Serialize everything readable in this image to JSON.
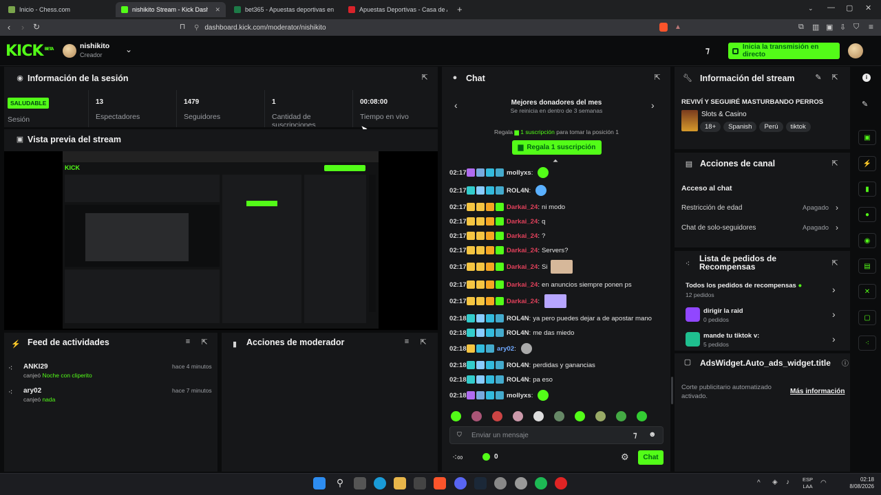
{
  "browser": {
    "tabs": [
      {
        "label": "Inicio - Chess.com"
      },
      {
        "label": "nishikito Stream - Kick Dashbo"
      },
      {
        "label": "bet365 - Apuestas deportivas en la re"
      },
      {
        "label": "Apuestas Deportivas - Casa de Apues"
      }
    ],
    "url": "dashboard.kick.com/moderator/nishikito"
  },
  "header": {
    "logo": "KICK",
    "logo_badge": "BETA",
    "username": "nishikito",
    "role": "Creador",
    "start_button": "Inicia la transmisión en directo"
  },
  "session": {
    "title": "Información de la sesión",
    "status": "SALUDABLE",
    "session_label": "Sesión",
    "stats": [
      {
        "value": "13",
        "label": "Espectadores"
      },
      {
        "value": "1479",
        "label": "Seguidores"
      },
      {
        "value": "1",
        "label": "Cantidad de suscripciones"
      },
      {
        "value": "00:08:00",
        "label": "Tiempo en vivo"
      }
    ]
  },
  "preview": {
    "title": "Vista previa del stream"
  },
  "activity": {
    "title": "Feed de actividades",
    "items": [
      {
        "user": "ANKI29",
        "action": "canjeó",
        "reward": "Noche con cliperito",
        "time": "hace 4 minutos"
      },
      {
        "user": "ary02",
        "action": "canjeó",
        "reward": "nada",
        "time": "hace 7 minutos"
      }
    ]
  },
  "mod_actions": {
    "title": "Acciones de moderador"
  },
  "chat": {
    "title": "Chat",
    "donors_title": "Mejores donadores del mes",
    "donors_sub": "Se reinicia en dentro de 3 semanas",
    "gift_prefix": "Regala",
    "gift_link": "1 suscripción",
    "gift_suffix": "para tomar la posición 1",
    "gift_button": "Regala 1 suscripción",
    "messages": [
      {
        "time": "02:17",
        "user": "mollyxs",
        "text": "",
        "color": "#e0e0e0"
      },
      {
        "time": "02:17",
        "user": "ROL4N",
        "text": "",
        "color": "#e0e0e0"
      },
      {
        "time": "02:17",
        "user": "Darkai_24",
        "text": "ni modo",
        "color": "#e0405a"
      },
      {
        "time": "02:17",
        "user": "Darkai_24",
        "text": "q",
        "color": "#e0405a"
      },
      {
        "time": "02:17",
        "user": "Darkai_24",
        "text": "?",
        "color": "#e0405a"
      },
      {
        "time": "02:17",
        "user": "Darkai_24",
        "text": "Servers?",
        "color": "#e0405a"
      },
      {
        "time": "02:17",
        "user": "Darkai_24",
        "text": "Si",
        "color": "#e0405a"
      },
      {
        "time": "02:17",
        "user": "Darkai_24",
        "text": "en anuncios siempre ponen ps",
        "color": "#e0405a"
      },
      {
        "time": "02:17",
        "user": "Darkai_24",
        "text": "",
        "color": "#e0405a"
      },
      {
        "time": "02:18",
        "user": "ROL4N",
        "text": "ya pero puedes dejar a de apostar mano",
        "color": "#e0e0e0"
      },
      {
        "time": "02:18",
        "user": "ROL4N",
        "text": "me das miedo",
        "color": "#e0e0e0"
      },
      {
        "time": "02:18",
        "user": "ary02",
        "text": "",
        "color": "#6fa8ff"
      },
      {
        "time": "02:18",
        "user": "ROL4N",
        "text": "perdidas y ganancias",
        "color": "#e0e0e0"
      },
      {
        "time": "02:18",
        "user": "ROL4N",
        "text": "pa eso",
        "color": "#e0e0e0"
      },
      {
        "time": "02:18",
        "user": "mollyxs",
        "text": "",
        "color": "#e0e0e0"
      }
    ],
    "input_placeholder": "Enviar un mensaje",
    "points": "0",
    "send_button": "Chat"
  },
  "stream_info": {
    "title": "Información del stream",
    "stream_title": "REVIVÍ Y SEGUIRÉ MASTURBANDO PERROS",
    "category": "Slots & Casino",
    "tags": [
      "18+",
      "Spanish",
      "Perú",
      "tiktok"
    ]
  },
  "channel_actions": {
    "title": "Acciones de canal",
    "section": "Acceso al chat",
    "rows": [
      {
        "label": "Restricción de edad",
        "value": "Apagado"
      },
      {
        "label": "Chat de solo-seguidores",
        "value": "Apagado"
      }
    ]
  },
  "rewards": {
    "title": "Lista de pedidos de Recompensas",
    "all_label": "Todos los pedidos de recompensas",
    "all_count": "12 pedidos",
    "items": [
      {
        "name": "dirigir la raid",
        "count": "0 pedidos"
      },
      {
        "name": "mande tu tiktok v:",
        "count": "5 pedidos"
      }
    ]
  },
  "ads": {
    "title": "AdsWidget.Auto_ads_widget.title",
    "text": "Corte publicitario automatizado activado.",
    "link": "Más información"
  },
  "taskbar": {
    "lang1": "ESP",
    "lang2": "LAA",
    "time": "02:18",
    "date": "8/08/2026"
  },
  "colors": {
    "accent": "#53fc18",
    "panel": "#161719",
    "bg": "#0b0c0d"
  }
}
